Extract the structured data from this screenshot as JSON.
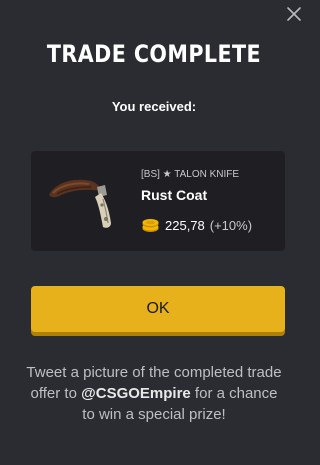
{
  "title": "TRADE COMPLETE",
  "received_label": "You received:",
  "item": {
    "name": "[BS] ★ TALON KNIFE",
    "skin": "Rust Coat",
    "price": "225,78",
    "bonus": "(+10%)"
  },
  "ok_label": "OK",
  "tweet": {
    "before": "Tweet a picture of the completed trade offer to ",
    "handle": "@CSGOEmpire",
    "after": " for a chance to win a special prize!"
  },
  "colors": {
    "background": "#2b2c31",
    "card": "#1f1f23",
    "accent": "#e7b11b",
    "coin": "#f2b705"
  },
  "icons": {
    "close": "close-icon",
    "coins": "coins-icon",
    "item": "knife-image"
  }
}
